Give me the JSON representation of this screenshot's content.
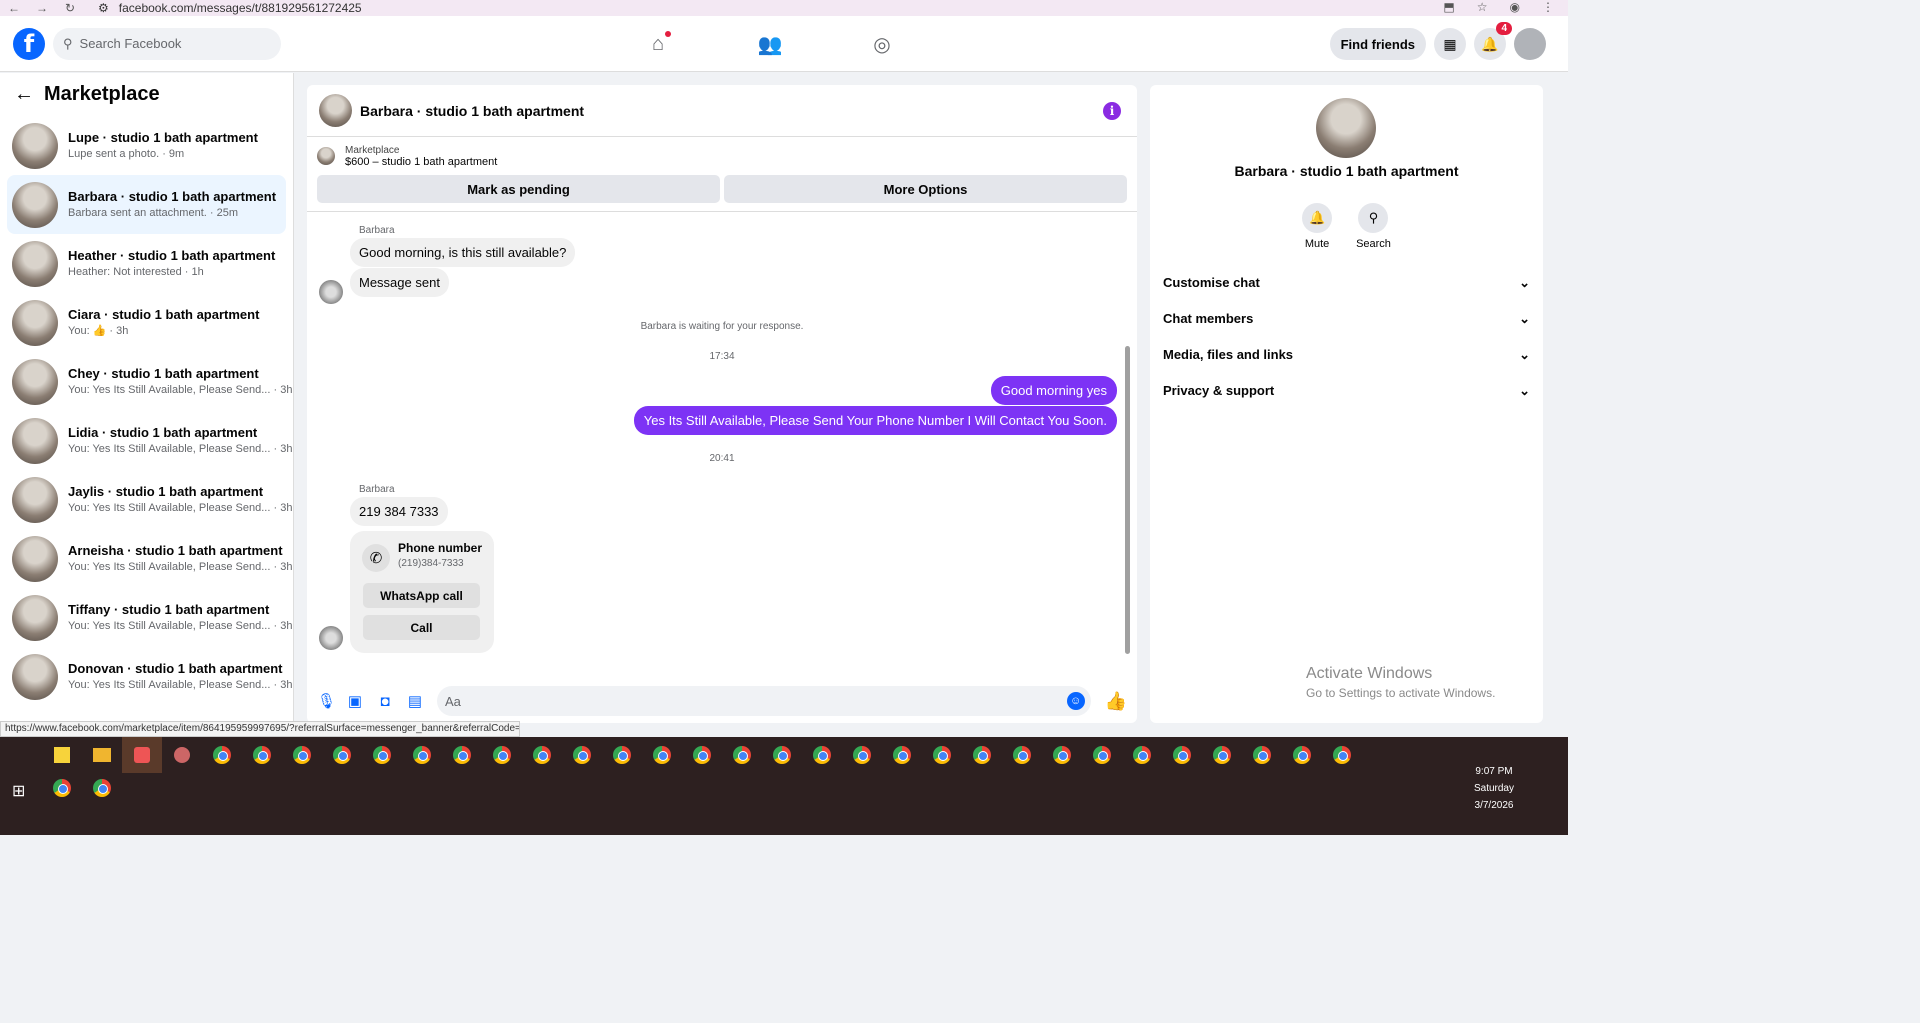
{
  "browser": {
    "url": "facebook.com/messages/t/881929561272425"
  },
  "header": {
    "search_placeholder": "Search Facebook",
    "find_friends": "Find friends",
    "notif_count": "4"
  },
  "sidebar": {
    "title": "Marketplace",
    "items": [
      {
        "name": "Lupe · studio 1 bath apartment",
        "sub": "Lupe sent a photo. · 9m"
      },
      {
        "name": "Barbara · studio 1 bath apartment",
        "sub": "Barbara sent an attachment. · 25m"
      },
      {
        "name": "Heather · studio 1 bath apartment",
        "sub": "Heather: Not interested · 1h"
      },
      {
        "name": "Ciara · studio 1 bath apartment",
        "sub": "You: 👍 · 3h"
      },
      {
        "name": "Chey · studio 1 bath apartment",
        "sub": "You: Yes Its Still Available, Please Send... · 3h"
      },
      {
        "name": "Lidia · studio 1 bath apartment",
        "sub": "You: Yes Its Still Available, Please Send... · 3h"
      },
      {
        "name": "Jaylis · studio 1 bath apartment",
        "sub": "You: Yes Its Still Available, Please Send... · 3h"
      },
      {
        "name": "Arneisha · studio 1 bath apartment",
        "sub": "You: Yes Its Still Available, Please Send... · 3h"
      },
      {
        "name": "Tiffany · studio 1 bath apartment",
        "sub": "You: Yes Its Still Available, Please Send... · 3h"
      },
      {
        "name": "Donovan · studio 1 bath apartment",
        "sub": "You: Yes Its Still Available, Please Send... · 3h"
      }
    ]
  },
  "chat": {
    "title": "Barbara · studio 1 bath apartment",
    "listing_label": "Marketplace",
    "listing_price": "$600 – studio 1 bath apartment",
    "mark_pending": "Mark as pending",
    "more_options": "More Options",
    "sender": "Barbara",
    "msg1": "Good morning, is this still available?",
    "msg2": "Message sent",
    "waiting": "Barbara is waiting for your response.",
    "time1": "17:34",
    "out1": "Good morning yes",
    "out2": "Yes Its Still Available, Please Send Your Phone Number I Will Contact You Soon.",
    "time2": "20:41",
    "sender2": "Barbara",
    "msg3": "219 384 7333",
    "card_label": "Phone number",
    "card_number": "(219)384-7333",
    "whatsapp": "WhatsApp call",
    "call": "Call",
    "composer_placeholder": "Aa"
  },
  "right_panel": {
    "title": "Barbara · studio 1 bath apartment",
    "mute": "Mute",
    "search": "Search",
    "sections": [
      "Customise chat",
      "Chat members",
      "Media, files and links",
      "Privacy & support"
    ]
  },
  "watermark": {
    "line1": "Activate Windows",
    "line2": "Go to Settings to activate Windows."
  },
  "status_url": "https://www.facebook.com/marketplace/item/864195959997695/?referralSurface=messenger_banner&referralCode=2",
  "taskbar": {
    "time": "9:07 PM",
    "day": "Saturday",
    "date": "3/7/2026"
  },
  "colors": {
    "accent": "#0866ff",
    "outgoing": "#7d33f5"
  }
}
